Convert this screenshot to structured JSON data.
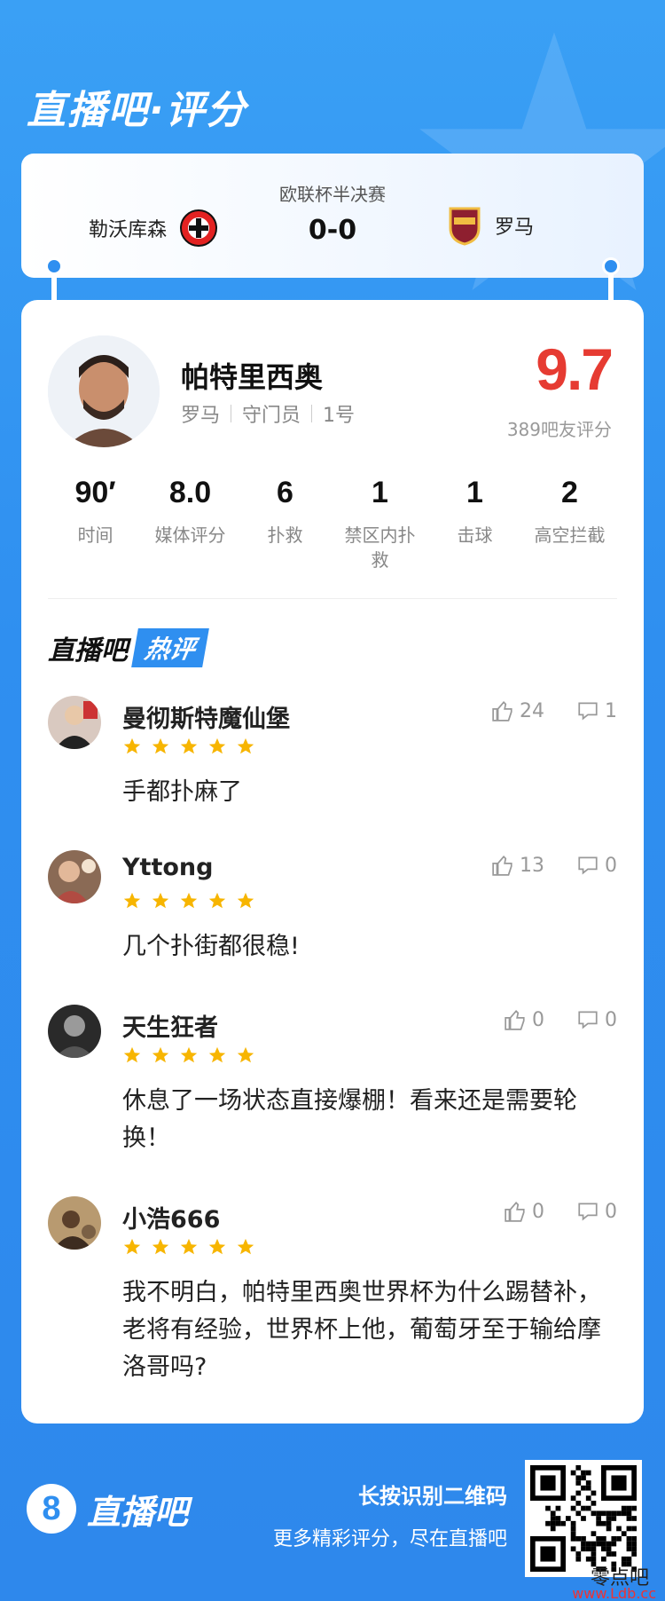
{
  "header": {
    "title": "直播吧·评分"
  },
  "match": {
    "home_team": "勒沃库森",
    "away_team": "罗马",
    "competition": "欧联杯半决赛",
    "score": "0-0",
    "home_logo_text": "BAYER 04 LEVERKUSEN",
    "away_logo_text": "ROMA"
  },
  "player": {
    "name": "帕特里西奥",
    "team": "罗马",
    "position": "守门员",
    "number": "1号",
    "rating": "9.7",
    "rating_count": "389吧友评分"
  },
  "stats": [
    {
      "value": "90′",
      "label": "时间"
    },
    {
      "value": "8.0",
      "label": "媒体评分"
    },
    {
      "value": "6",
      "label": "扑救"
    },
    {
      "value": "1",
      "label": "禁区内扑救"
    },
    {
      "value": "1",
      "label": "击球"
    },
    {
      "value": "2",
      "label": "高空拦截"
    }
  ],
  "hot_comments": {
    "title_a": "直播吧",
    "title_b": "热评",
    "items": [
      {
        "user": "曼彻斯特魔仙堡",
        "stars": 5,
        "likes": "24",
        "replies": "1",
        "text": "手都扑麻了"
      },
      {
        "user": "Yttong",
        "stars": 5,
        "likes": "13",
        "replies": "0",
        "text": "几个扑街都很稳!"
      },
      {
        "user": "天生狂者",
        "stars": 5,
        "likes": "0",
        "replies": "0",
        "text": "休息了一场状态直接爆棚！看来还是需要轮换！"
      },
      {
        "user": "小浩666",
        "stars": 5,
        "likes": "0",
        "replies": "0",
        "text": "我不明白，帕特里西奥世界杯为什么踢替补，老将有经验，世界杯上他，葡萄牙至于输给摩洛哥吗?"
      }
    ]
  },
  "footer": {
    "logo_number": "8",
    "logo_text": "直播吧",
    "tip_line1": "长按识别二维码",
    "tip_line2": "更多精彩评分，尽在直播吧"
  },
  "watermark": {
    "line1": "零点吧",
    "line2": "www.Ldb.cc"
  },
  "colors": {
    "accent": "#2f8ff0",
    "rating": "#e63b32",
    "star": "#f7b500"
  }
}
